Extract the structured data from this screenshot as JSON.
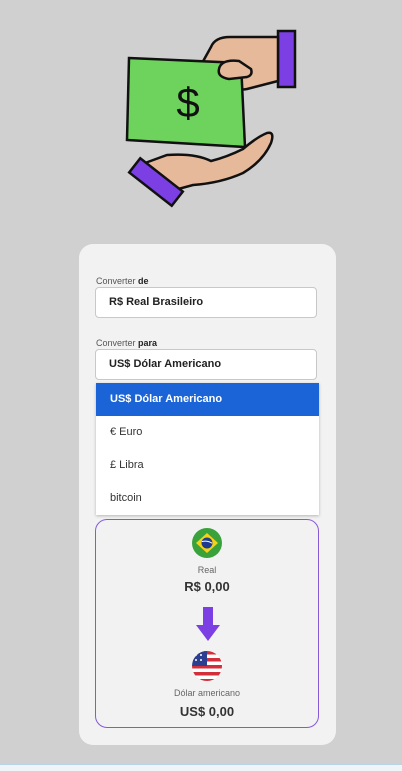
{
  "form": {
    "from_label_prefix": "Converter",
    "from_label_bold": "de",
    "from_value": "R$ Real Brasileiro",
    "to_label_prefix": "Converter",
    "to_label_bold": "para",
    "to_value": "US$ Dólar Americano",
    "to_options": [
      "US$ Dólar Americano",
      "€ Euro",
      "£ Libra",
      "bitcoin"
    ]
  },
  "result": {
    "from_currency_name": "Real",
    "from_amount": "R$ 0,00",
    "to_currency_name": "Dólar americano",
    "to_amount": "US$ 0,00"
  },
  "icons": {
    "hero": "money-exchange-illustration",
    "from_flag": "brazil-flag-icon",
    "arrow": "arrow-down-icon",
    "to_flag": "usa-flag-icon"
  },
  "colors": {
    "accent": "#7b3fe4",
    "selected_option": "#1a64d8",
    "banknote": "#6dd35c",
    "skin": "#e6b99a"
  }
}
